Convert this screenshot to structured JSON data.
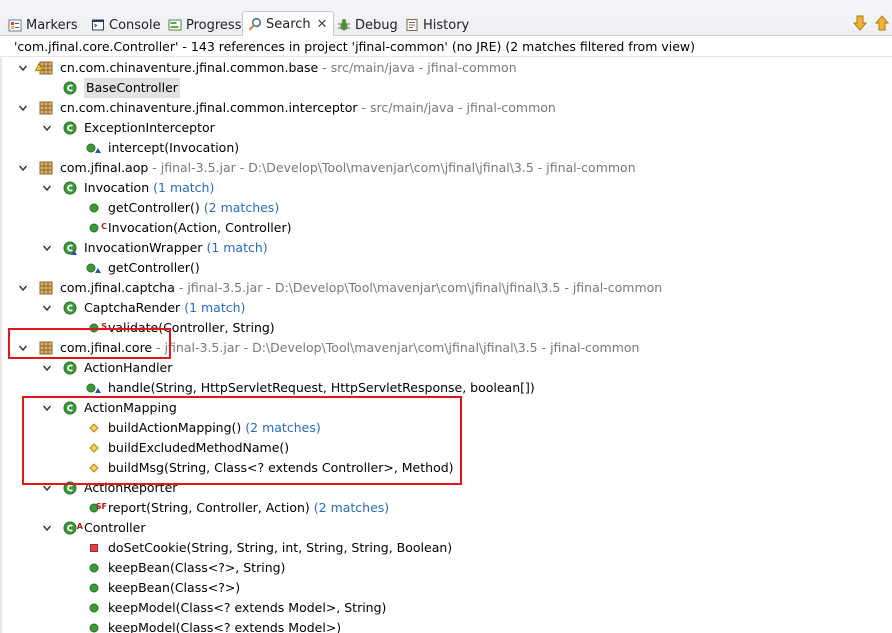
{
  "tabs": [
    {
      "label": "Markers",
      "icon": "markers-icon"
    },
    {
      "label": "Console",
      "icon": "console-icon"
    },
    {
      "label": "Progress",
      "icon": "progress-icon"
    },
    {
      "label": "Search",
      "icon": "search-icon",
      "active": true
    },
    {
      "label": "Debug",
      "icon": "debug-icon"
    },
    {
      "label": "History",
      "icon": "history-icon"
    }
  ],
  "status_text": "'com.jfinal.core.Controller' - 143 references in project 'jfinal-common' (no JRE) (2 matches filtered from view)",
  "tree": [
    {
      "label": "cn.com.chinaventure.jfinal.common.base",
      "decoration": " - src/main/java - jfinal-common",
      "icon": "package",
      "expanded": true,
      "level": 0,
      "overlay": "warning"
    },
    {
      "label": "BaseController",
      "icon": "class",
      "level": 1,
      "selected": true
    },
    {
      "label": "cn.com.chinaventure.jfinal.common.interceptor",
      "decoration": " - src/main/java - jfinal-common",
      "icon": "package",
      "expanded": true,
      "level": 0
    },
    {
      "label": "ExceptionInterceptor",
      "icon": "class",
      "expanded": true,
      "level": 1
    },
    {
      "label": "intercept(Invocation)",
      "icon": "method-public-default",
      "level": 2
    },
    {
      "label": "com.jfinal.aop",
      "decoration": " - jfinal-3.5.jar - D:\\Develop\\Tool\\mavenjar\\com\\jfinal\\jfinal\\3.5 - jfinal-common",
      "icon": "package",
      "expanded": true,
      "level": 0
    },
    {
      "label": "Invocation",
      "count": "(1 match)",
      "icon": "class",
      "expanded": true,
      "level": 1
    },
    {
      "label": "getController()",
      "count": "(2 matches)",
      "icon": "method-public",
      "level": 2
    },
    {
      "label": "Invocation(Action, Controller)",
      "icon": "constructor",
      "level": 2
    },
    {
      "label": "InvocationWrapper",
      "count": "(1 match)",
      "icon": "class-default",
      "expanded": true,
      "level": 1
    },
    {
      "label": "getController()",
      "icon": "method-public-default",
      "level": 2
    },
    {
      "label": "com.jfinal.captcha",
      "decoration": " - jfinal-3.5.jar - D:\\Develop\\Tool\\mavenjar\\com\\jfinal\\jfinal\\3.5 - jfinal-common",
      "icon": "package",
      "expanded": true,
      "level": 0
    },
    {
      "label": "CaptchaRender",
      "count": "(1 match)",
      "icon": "class",
      "expanded": true,
      "level": 1
    },
    {
      "label": "validate(Controller, String)",
      "icon": "method-static",
      "level": 2
    },
    {
      "label": "com.jfinal.core",
      "decoration": " - jfinal-3.5.jar - D:\\Develop\\Tool\\mavenjar\\com\\jfinal\\jfinal\\3.5 - jfinal-common",
      "icon": "package",
      "expanded": true,
      "level": 0
    },
    {
      "label": "ActionHandler",
      "icon": "class",
      "expanded": true,
      "level": 1
    },
    {
      "label": "handle(String, HttpServletRequest, HttpServletResponse, boolean[])",
      "icon": "method-public-default",
      "level": 2
    },
    {
      "label": "ActionMapping",
      "icon": "class",
      "expanded": true,
      "level": 1
    },
    {
      "label": "buildActionMapping()",
      "count": "(2 matches)",
      "icon": "method-protected",
      "level": 2
    },
    {
      "label": "buildExcludedMethodName()",
      "icon": "method-protected",
      "level": 2
    },
    {
      "label": "buildMsg(String, Class<? extends Controller>, Method)",
      "icon": "method-protected",
      "level": 2
    },
    {
      "label": "ActionReporter",
      "icon": "class",
      "expanded": true,
      "level": 1
    },
    {
      "label": "report(String, Controller, Action)",
      "count": "(2 matches)",
      "icon": "method-static-final",
      "level": 2
    },
    {
      "label": "Controller",
      "icon": "class-abstract",
      "expanded": true,
      "level": 1
    },
    {
      "label": "doSetCookie(String, String, int, String, String, Boolean)",
      "icon": "method-private",
      "level": 2
    },
    {
      "label": "keepBean(Class<?>, String)",
      "icon": "method-public",
      "level": 2
    },
    {
      "label": "keepBean(Class<?>)",
      "icon": "method-public",
      "level": 2
    },
    {
      "label": "keepModel(Class<? extends Model>, String)",
      "icon": "method-public",
      "level": 2
    },
    {
      "label": "keepModel(Class<? extends Model>)",
      "icon": "method-public",
      "level": 2
    }
  ],
  "colors": {
    "accent": "#e3161b",
    "match_count": "#2a6cb8",
    "decoration": "#7a7a7a",
    "class_icon": "#3d9a3b",
    "package_icon": "#b88a3a"
  },
  "toolbar": {
    "next_icon": "arrow-down-icon",
    "prev_icon": "arrow-up-icon"
  }
}
